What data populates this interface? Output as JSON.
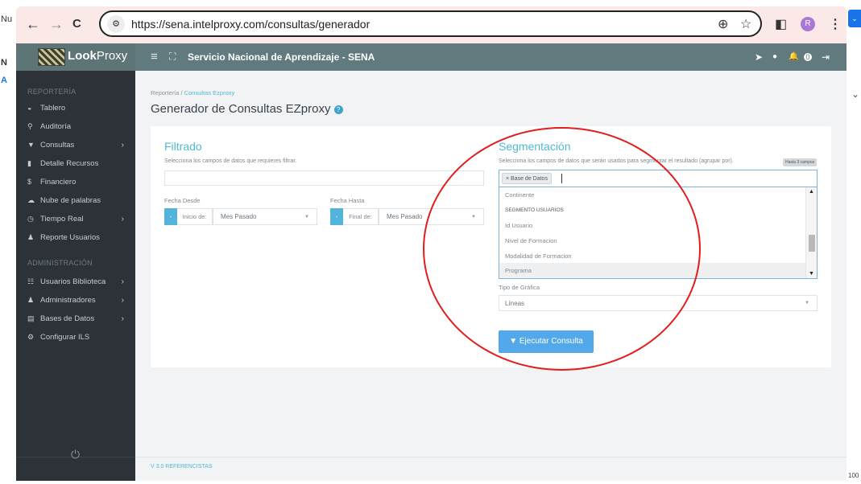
{
  "browser": {
    "back_glyph": "←",
    "forward_glyph": "→",
    "reload_glyph": "C",
    "site_glyph": "⚙",
    "url": "https://sena.intelproxy.com/consultas/generador",
    "zoom_glyph": "⊕",
    "star_glyph": "☆",
    "panel_glyph": "◧",
    "avatar": "R",
    "menu_glyph": "⋮",
    "profile_color": "#a978d6"
  },
  "left_edge": {
    "t1": "Nu",
    "t2": "N",
    "t3": "A"
  },
  "right_edge": {
    "ext": "⌄",
    "chev": "⌄",
    "zoom": "100"
  },
  "app": {
    "brand_bold": "Look",
    "brand_rest": "Proxy",
    "menu_glyph": "≡",
    "expand_glyph": "⛶",
    "org_name": "Servicio Nacional de Aprendizaje - SENA",
    "icons": {
      "send": "➤",
      "help": "●",
      "bell": "🔔",
      "badge": "0",
      "logout": "⇥"
    }
  },
  "sidebar": {
    "section1": "REPORTERÍA",
    "items1": [
      {
        "icon": "◒",
        "label": "Tablero",
        "chev": ""
      },
      {
        "icon": "⚲",
        "label": "Auditoría",
        "chev": ""
      },
      {
        "icon": "▼",
        "label": "Consultas",
        "chev": "›"
      },
      {
        "icon": "▮",
        "label": "Detalle Recursos",
        "chev": ""
      },
      {
        "icon": "$",
        "label": "Financiero",
        "chev": ""
      },
      {
        "icon": "☁",
        "label": "Nube de palabras",
        "chev": ""
      },
      {
        "icon": "◷",
        "label": "Tiempo Real",
        "chev": "›"
      },
      {
        "icon": "♟",
        "label": "Reporte Usuarios",
        "chev": ""
      }
    ],
    "section2": "ADMINISTRACIÓN",
    "items2": [
      {
        "icon": "☷",
        "label": "Usuarios Biblioteca",
        "chev": "›"
      },
      {
        "icon": "♟",
        "label": "Administradores",
        "chev": "›"
      },
      {
        "icon": "▤",
        "label": "Bases de Datos",
        "chev": "›"
      },
      {
        "icon": "⚙",
        "label": "Configurar ILS",
        "chev": ""
      }
    ],
    "power_glyph": "⏻"
  },
  "breadcrumb": {
    "root": "Reportería",
    "sep": "/",
    "current": "Consultas Ezproxy"
  },
  "page": {
    "title": "Generador de Consultas EZproxy",
    "help_glyph": "?"
  },
  "filtrado": {
    "title": "Filtrado",
    "subtitle": "Selecciona los campos de datos que requieres filtrar.",
    "input_value": "",
    "fecha_desde": {
      "label": "Fecha Desde",
      "btn": "-",
      "prefix": "Inicio de:",
      "value": "Mes Pasado",
      "caret": "▼"
    },
    "fecha_hasta": {
      "label": "Fecha Hasta",
      "btn": "-",
      "prefix": "Final de:",
      "value": "Mes Pasado",
      "caret": "▼"
    }
  },
  "segmentacion": {
    "title": "Segmentación",
    "subtitle": "Selecciona los campos de datos que serán usados para segmentar el resultado (agrupar por).",
    "badge": "Hasta 3 campos",
    "selected_tag": "× Base de Datos",
    "options": [
      {
        "label": "Continente",
        "type": "option"
      },
      {
        "label": "SEGMENTO USUARIOS",
        "type": "header"
      },
      {
        "label": "Id Usuario",
        "type": "option"
      },
      {
        "label": "Nivel de Formacion",
        "type": "option"
      },
      {
        "label": "Modalidad de Formacion",
        "type": "option"
      },
      {
        "label": "Programa",
        "type": "highlighted"
      }
    ],
    "scroll": {
      "up": "▲",
      "down": "▼"
    }
  },
  "grafica": {
    "label": "Tipo de Gráfica",
    "value": "Líneas",
    "caret": "▼"
  },
  "run_button": {
    "icon": "▼",
    "label": "Ejecutar Consulta"
  },
  "footer": {
    "version": "V 3.0 REFERENCISTAS"
  },
  "colors": {
    "accent": "#52b8d4",
    "sidebar": "#2c3238",
    "topbar": "#607a7e",
    "annotation": "#e21d1d",
    "button": "#53a8ea"
  }
}
